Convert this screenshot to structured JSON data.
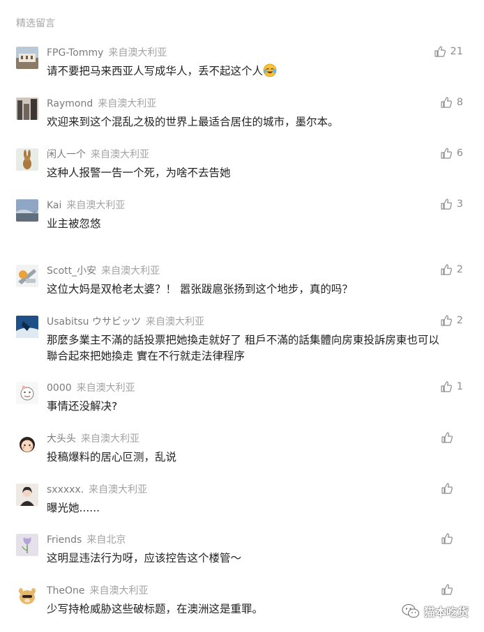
{
  "section_title": "精选留言",
  "comments": [
    {
      "nickname": "FPG-Tommy",
      "region": "来自澳大利亚",
      "text": "请不要把马来西亚人写成华人，丢不起这个人",
      "likes": "21"
    },
    {
      "nickname": "Raymond",
      "region": "来自澳大利亚",
      "text": "欢迎来到这个混乱之极的世界上最适合居住的城市，墨尔本。",
      "likes": "8"
    },
    {
      "nickname": "闲人一个",
      "region": "来自澳大利亚",
      "text": "这种人报警一告一个死，为啥不去告她",
      "likes": "6"
    },
    {
      "nickname": "Kai",
      "region": "来自澳大利亚",
      "text": "业主被忽悠",
      "likes": "3"
    },
    {
      "nickname": "Scott_小安",
      "region": "来自澳大利亚",
      "text": "这位大妈是双枪老太婆？！ 嚣张跋扈张扬到这个地步，真的吗？",
      "likes": "2"
    },
    {
      "nickname": "Usabitsu ウサビッツ",
      "region": "来自澳大利亚",
      "text_line1": "那麼多業主不滿的話投票把她換走就好了 租戶不滿的話集體向房東投訴房東也可以",
      "text_line2": "聯合起來把她換走 實在不行就走法律程序",
      "likes": "2"
    },
    {
      "nickname": "0000",
      "region": "来自澳大利亚",
      "text": "事情还没解决?",
      "likes": "1"
    },
    {
      "nickname": "大头头",
      "region": "来自澳大利亚",
      "text": "投稿爆料的居心叵测，乱说",
      "likes": ""
    },
    {
      "nickname": "sxxxxx.",
      "region": "来自澳大利亚",
      "text": "曝光她......",
      "likes": ""
    },
    {
      "nickname": "Friends",
      "region": "来自北京",
      "text": "这明显违法行为呀，应该控告这个楼管～",
      "likes": ""
    },
    {
      "nickname": "TheOne",
      "region": "来自澳大利亚",
      "text": "少写持枪威胁这些破标题，在澳洲这是重罪。",
      "likes": ""
    }
  ],
  "icons": {
    "like": "thumbs-up-icon",
    "emoji": "laughing-crying-emoji-icon",
    "watermark_logo": "wechat-icon"
  },
  "colors": {
    "nickname": "#7b7b7b",
    "region": "#a3a3a3",
    "text": "#222222",
    "like": "#8c8c8c"
  },
  "watermark": {
    "text": "猫本吃货"
  }
}
